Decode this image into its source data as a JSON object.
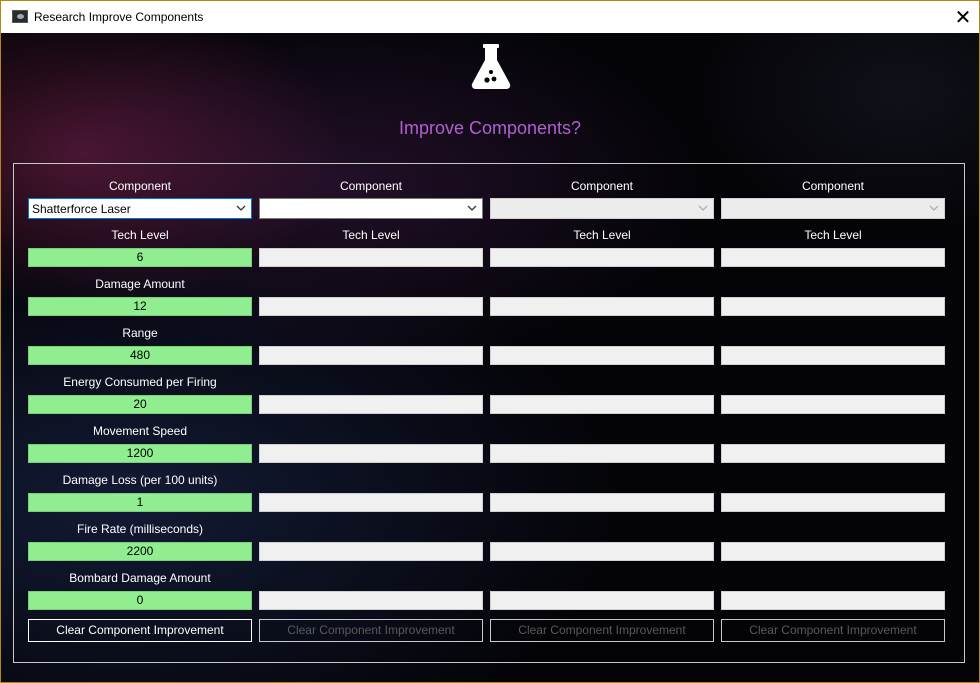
{
  "window": {
    "title": "Research Improve Components"
  },
  "heading": "Improve Components?",
  "columns": [
    {
      "component_label": "Component",
      "selected": "Shatterforce Laser",
      "tech_label": "Tech Level",
      "tech_value": "6",
      "stats": [
        {
          "label": "Damage Amount",
          "value": "12"
        },
        {
          "label": "Range",
          "value": "480"
        },
        {
          "label": "Energy Consumed per Firing",
          "value": "20"
        },
        {
          "label": "Movement Speed",
          "value": "1200"
        },
        {
          "label": "Damage Loss (per 100 units)",
          "value": "1"
        },
        {
          "label": "Fire Rate (milliseconds)",
          "value": "2200"
        },
        {
          "label": "Bombard Damage Amount",
          "value": "0"
        }
      ],
      "clear_label": "Clear Component Improvement"
    },
    {
      "component_label": "Component",
      "selected": "",
      "tech_label": "Tech Level",
      "clear_label": "Clear Component Improvement"
    },
    {
      "component_label": "Component",
      "selected": "",
      "tech_label": "Tech Level",
      "clear_label": "Clear Component Improvement"
    },
    {
      "component_label": "Component",
      "selected": "",
      "tech_label": "Tech Level",
      "clear_label": "Clear Component Improvement"
    }
  ],
  "colors": {
    "heading": "#b060d0",
    "value_field": "#90ee90",
    "window_border": "#b8860b"
  }
}
